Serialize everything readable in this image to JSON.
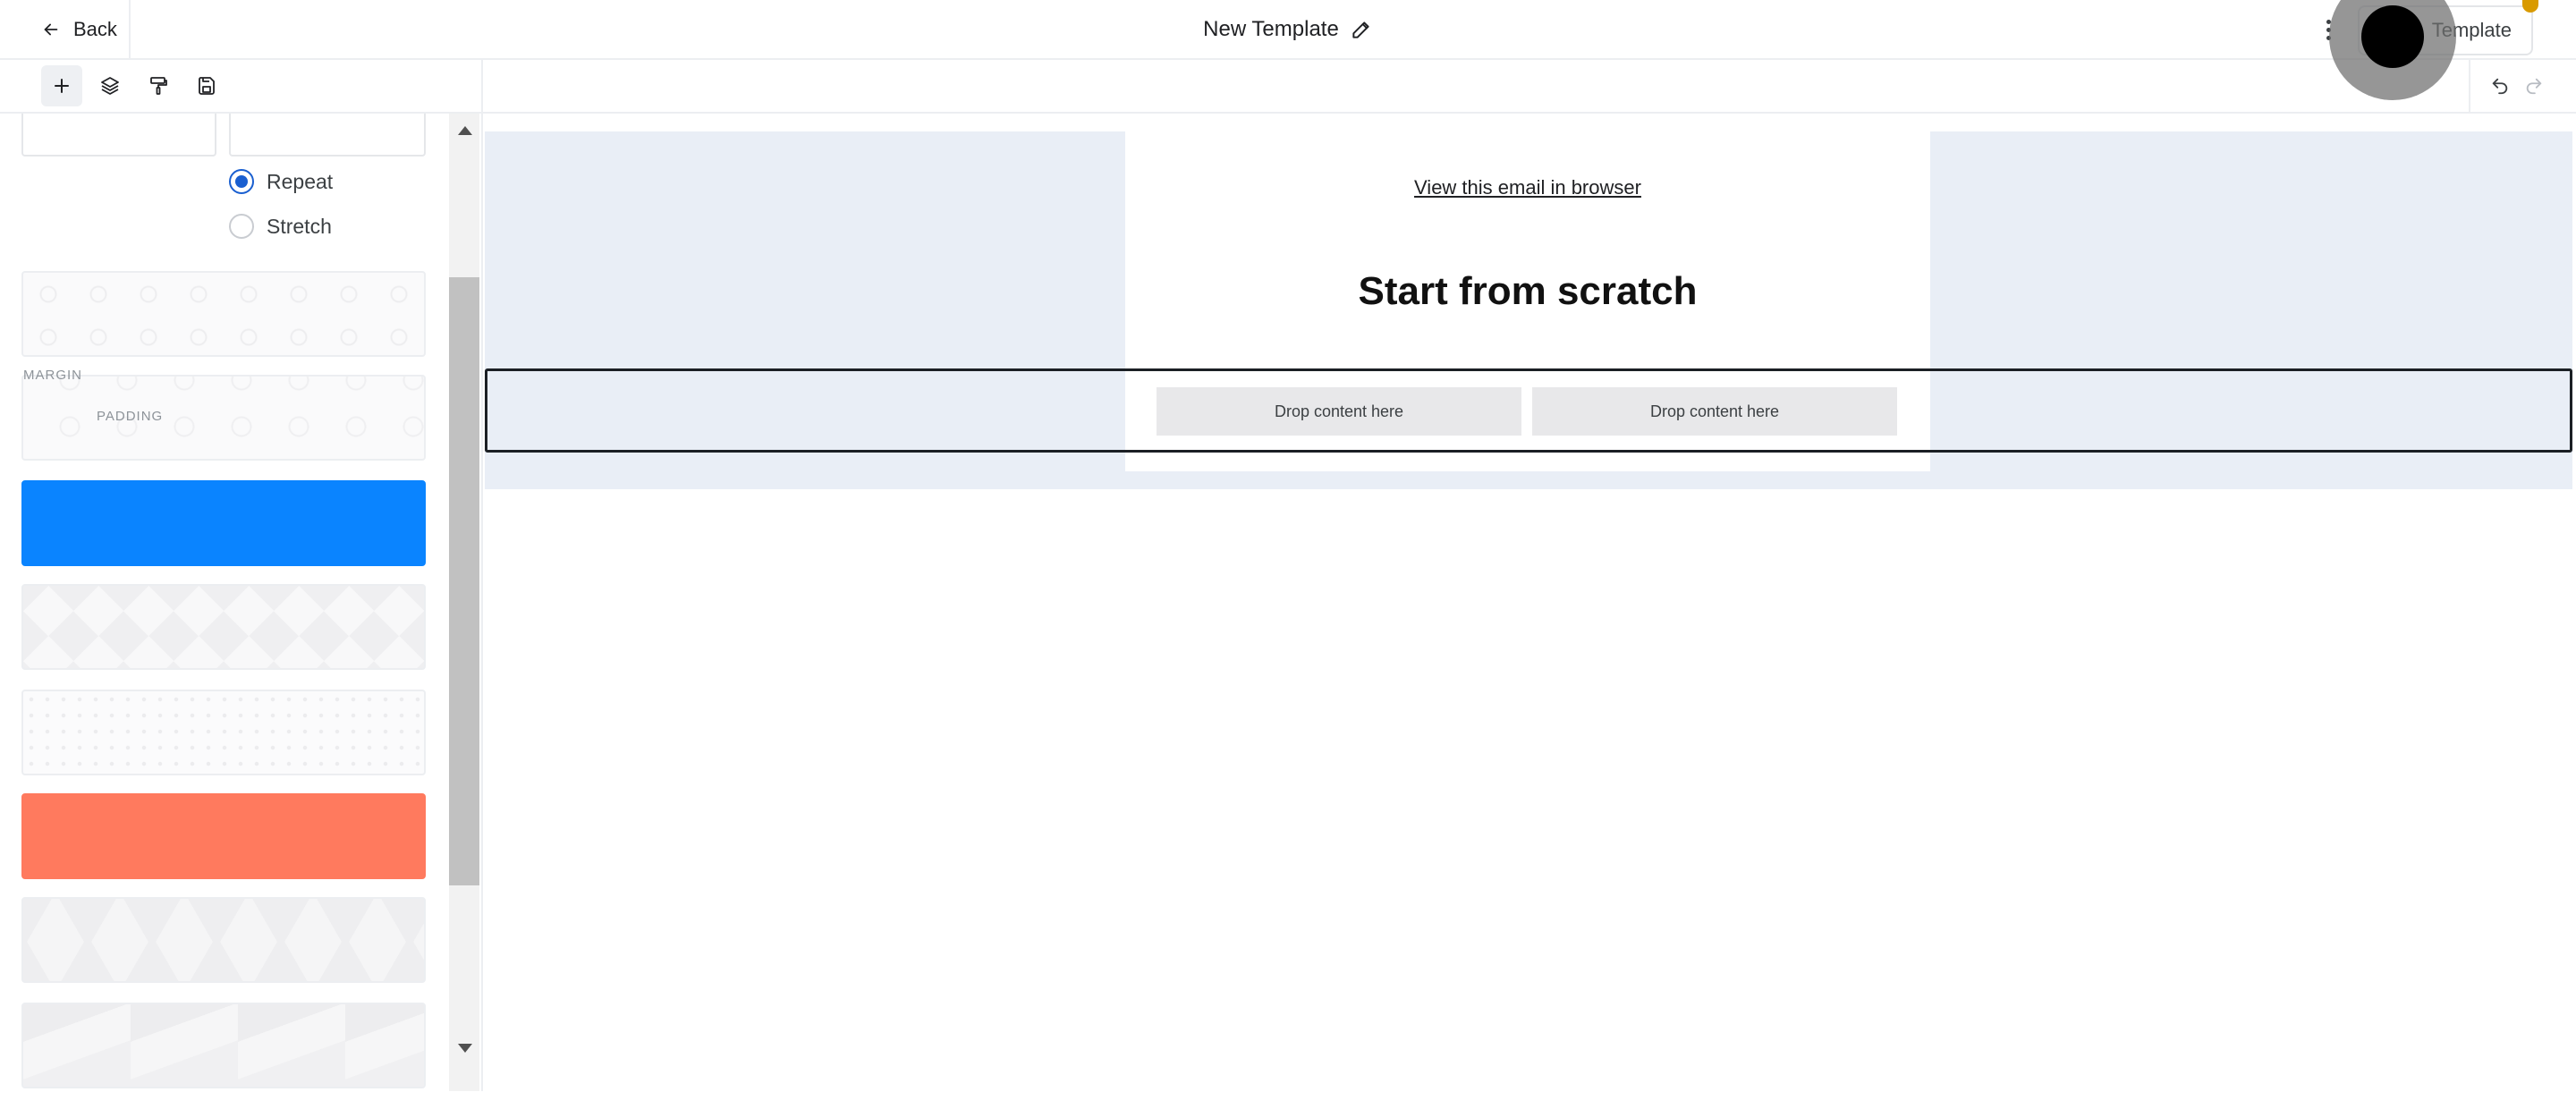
{
  "header": {
    "back_label": "Back",
    "title": "New Template",
    "template_button_label": "Template",
    "accent_dot_color": "#d99a00"
  },
  "toolbar": {
    "tools": [
      {
        "name": "add",
        "icon": "plus-icon",
        "active": true
      },
      {
        "name": "layers",
        "icon": "layers-icon",
        "active": false
      },
      {
        "name": "style",
        "icon": "paint-roller-icon",
        "active": false
      },
      {
        "name": "save",
        "icon": "save-icon",
        "active": false
      }
    ],
    "undo_icon": "undo-icon",
    "redo_icon": "redo-icon"
  },
  "sidebar": {
    "background_mode": {
      "options": [
        "Repeat",
        "Stretch"
      ],
      "selected": "Repeat"
    },
    "spacing_labels": {
      "margin": "MARGIN",
      "padding": "PADDING"
    },
    "swatches": [
      {
        "type": "pattern",
        "pattern": "circles"
      },
      {
        "type": "pattern",
        "pattern": "circles-rings"
      },
      {
        "type": "color",
        "color": "#0a84ff"
      },
      {
        "type": "pattern",
        "pattern": "triangles"
      },
      {
        "type": "pattern",
        "pattern": "dots"
      },
      {
        "type": "color",
        "color": "#ff7a5e"
      },
      {
        "type": "pattern",
        "pattern": "large-triangles"
      },
      {
        "type": "pattern",
        "pattern": "diagonal"
      }
    ]
  },
  "canvas": {
    "view_in_browser": "View this email in browser",
    "headline": "Start from scratch",
    "drop_zones": [
      "Drop content here",
      "Drop content here"
    ],
    "background_color": "#e9eef6"
  }
}
